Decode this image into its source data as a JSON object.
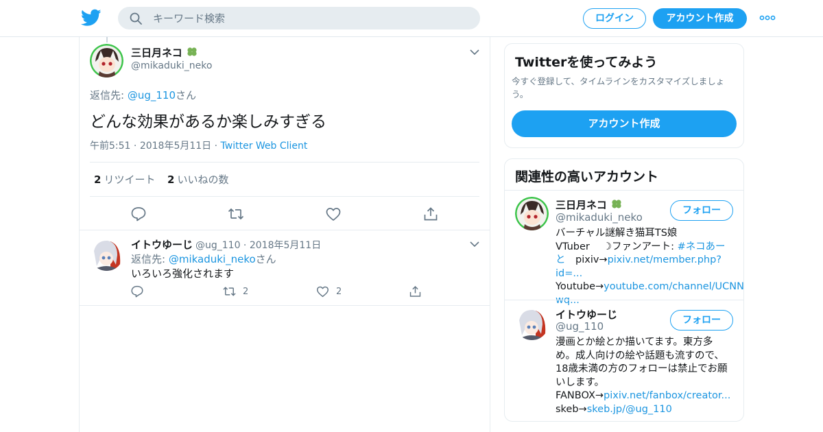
{
  "search": {
    "placeholder": "キーワード検索"
  },
  "header": {
    "login_label": "ログイン",
    "signup_label": "アカウント作成"
  },
  "tweet": {
    "author_name": "三日月ネコ",
    "author_handle": "@mikaduki_neko",
    "reply_prefix": "返信先: ",
    "reply_to": "@ug_110",
    "reply_suffix": "さん",
    "text": "どんな効果があるか楽しみすぎる",
    "time": "午前5:51",
    "date": "2018年5月11日",
    "client": "Twitter Web Client",
    "retweet_count": "2",
    "retweet_label": "リツイート",
    "like_count": "2",
    "like_label": "いいねの数"
  },
  "reply": {
    "author_name": "イトウゆーじ",
    "author_handle": "@ug_110",
    "date": "2018年5月11日",
    "reply_prefix": "返信先: ",
    "reply_to": "@mikaduki_neko",
    "reply_suffix": "さん",
    "text": "いろいろ強化されます",
    "retweet_count": "2",
    "like_count": "2"
  },
  "signup_card": {
    "title": "Twitterを使ってみよう",
    "description": "今すぐ登録して、タイムラインをカスタマイズしましょう。",
    "button_label": "アカウント作成"
  },
  "related": {
    "title": "関連性の高いアカウント",
    "follow_label": "フォロー",
    "accounts": [
      {
        "name": "三日月ネコ",
        "handle": "@mikaduki_neko",
        "bio_line1": "バーチャル謎解き猫耳TS娘",
        "bio_line2_text": "VTuber　 ☽ファンアート: ",
        "bio_hashtag_a": "#ネコあー",
        "bio_hashtag_b": "と",
        "bio_pixiv_label": "　pixiv→",
        "bio_pixiv_link": "pixiv.net/member.php?id=...",
        "bio_youtube_label": "Youtube→",
        "bio_youtube_link_a": "youtube.com/channel/UCNN",
        "bio_youtube_link_b": "wq..."
      },
      {
        "name": "イトウゆーじ",
        "handle": "@ug_110",
        "bio_line1": "漫画とか絵とか描いてます。東方多",
        "bio_line2": "め。成人向けの絵や話題も流すので、",
        "bio_line3": "18歳未満の方のフォローは禁止でお願",
        "bio_line4": "いします。",
        "bio_fanbox_label": "FANBOX→",
        "bio_fanbox_link": "pixiv.net/fanbox/creator...",
        "bio_skeb_label": "skeb→",
        "bio_skeb_link": "skeb.jp/@ug_110"
      }
    ]
  },
  "colors": {
    "accent": "#1da1f2",
    "link": "#1b95e0",
    "muted": "#657786",
    "clover": "#77b255"
  }
}
